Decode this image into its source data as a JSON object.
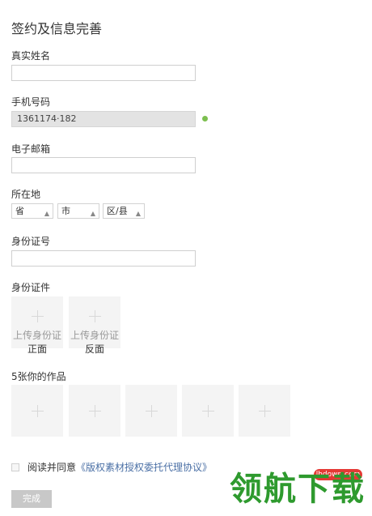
{
  "page": {
    "title": "签约及信息完善"
  },
  "fields": {
    "real_name": {
      "label": "真实姓名",
      "value": ""
    },
    "phone": {
      "label": "手机号码",
      "value": "1361174·182"
    },
    "email": {
      "label": "电子邮箱",
      "value": ""
    },
    "location": {
      "label": "所在地",
      "province": "省",
      "city": "市",
      "district": "区/县"
    },
    "id_number": {
      "label": "身份证号",
      "value": ""
    },
    "id_docs": {
      "label": "身份证件",
      "front_top": "上传身份证",
      "front_bottom": "正面",
      "back_top": "上传身份证",
      "back_bottom": "反面"
    },
    "works": {
      "label": "5张你的作品"
    }
  },
  "agreement": {
    "prefix": "阅读并同意",
    "link": "《版权素材授权委托代理协议》"
  },
  "submit_label": "完成",
  "watermark": {
    "text": "领航下载",
    "url": "lhdown.com"
  }
}
